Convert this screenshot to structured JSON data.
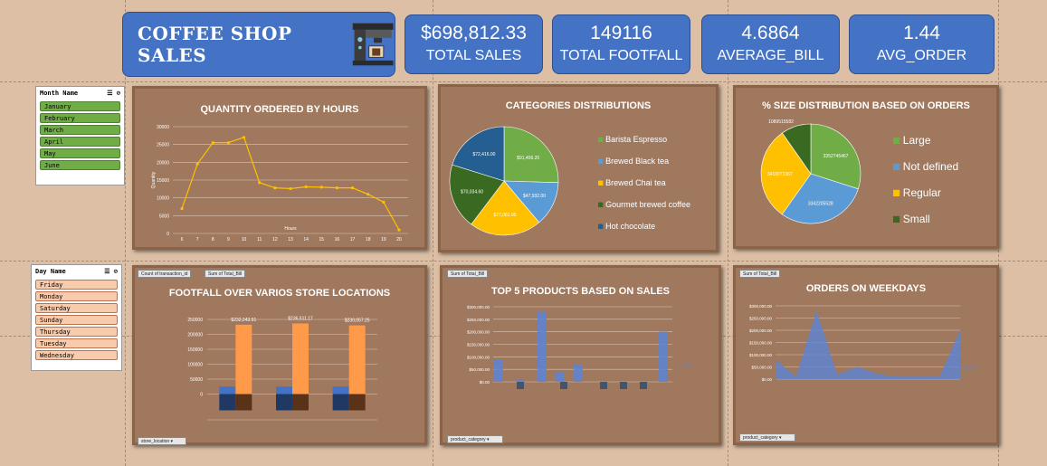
{
  "header": {
    "title": "COFFEE SHOP SALES",
    "icon": "coffee-machine-icon"
  },
  "kpis": [
    {
      "value": "$698,812.33",
      "label": "TOTAL SALES"
    },
    {
      "value": "149116",
      "label": "TOTAL FOOTFALL"
    },
    {
      "value": "4.6864",
      "label": "AVERAGE_BILL"
    },
    {
      "value": "1.44",
      "label": "AVG_ORDER"
    }
  ],
  "month_slicer": {
    "title": "Month Name",
    "items": [
      "January",
      "February",
      "March",
      "April",
      "May",
      "June"
    ],
    "item_color": "#70ad47"
  },
  "day_slicer": {
    "title": "Day Name",
    "items": [
      "Friday",
      "Monday",
      "Saturday",
      "Sunday",
      "Thursday",
      "Tuesday",
      "Wednesday"
    ],
    "item_color": "#f8cbad"
  },
  "panels": {
    "p1": {
      "title": "QUANTITY ORDERED BY HOURS"
    },
    "p2": {
      "title": "CATEGORIES DISTRIBUTIONS"
    },
    "p3": {
      "title": "% SIZE DISTRIBUTION BASED ON ORDERS"
    },
    "p4": {
      "title": "FOOTFALL OVER VARIOS STORE LOCATIONS",
      "fields": [
        "Count of transaction_id",
        "Sum of Total_Bill"
      ],
      "axis_field": "store_location"
    },
    "p5": {
      "title": "TOP 5 PRODUCTS BASED ON SALES",
      "fields": [
        "Sum of Total_Bill"
      ],
      "axis_field": "product_category"
    },
    "p6": {
      "title": "ORDERS ON WEEKDAYS",
      "fields": [
        "Sum of Total_Bill"
      ],
      "axis_field": "product_category"
    }
  },
  "chart_data": [
    {
      "type": "line",
      "title": "QUANTITY ORDERED BY HOURS",
      "xlabel": "Hours",
      "ylabel": "Quantity",
      "x": [
        6,
        7,
        8,
        9,
        10,
        11,
        12,
        13,
        14,
        15,
        16,
        17,
        18,
        19,
        20
      ],
      "values": [
        7000,
        19500,
        25500,
        25500,
        27000,
        14300,
        12800,
        12600,
        13100,
        13000,
        12800,
        12800,
        11000,
        8800,
        1000
      ],
      "ylim": [
        0,
        30000
      ],
      "yticks": [
        "0",
        "5000",
        "10000",
        "15000",
        "20000",
        "25000",
        "30000"
      ],
      "color": "#ffc000"
    },
    {
      "type": "pie",
      "title": "CATEGORIES DISTRIBUTIONS",
      "labels": [
        "Barista Espresso",
        "Brewed Black tea",
        "Brewed Chai tea",
        "Gourmet brewed coffee",
        "Hot chocolate"
      ],
      "values": [
        91406.2,
        47932.0,
        77081.95,
        70034.6,
        72416.0
      ],
      "data_labels": [
        "$91,406.20",
        "$47,932.00",
        "$77,081.95",
        "$70,034.60",
        "$72,416.00"
      ],
      "colors": [
        "#70ad47",
        "#5b9bd5",
        "#ffc000",
        "#3a6a22",
        "#255e91"
      ]
    },
    {
      "type": "pie",
      "title": "% SIZE DISTRIBUTION BASED ON ORDERS",
      "labels": [
        "Large",
        "Not defined",
        "Regular",
        "Small"
      ],
      "values": [
        3352745467,
        3342205528,
        3410071367,
        1089515582
      ],
      "data_labels": [
        "3352745467",
        "3342205528",
        "3410071367",
        "1089515582"
      ],
      "colors": [
        "#70ad47",
        "#5b9bd5",
        "#ffc000",
        "#3a6a22"
      ]
    },
    {
      "type": "bar",
      "title": "FOOTFALL OVER VARIOS STORE LOCATIONS",
      "categories": [
        "",
        "",
        ""
      ],
      "series": [
        {
          "values": [
            25000,
            25000,
            25000
          ],
          "color": "#4472c4"
        },
        {
          "values": [
            232243.91,
            236511.17,
            230057.25
          ],
          "color": "#ff9a4a"
        }
      ],
      "data_labels": [
        "$232,243.91",
        "$236,511.17",
        "$230,057.25"
      ],
      "yticks": [
        "0",
        "50000",
        "100000",
        "150000",
        "200000",
        "250000"
      ],
      "ylim": [
        -50000,
        250000
      ]
    },
    {
      "type": "bar",
      "title": "TOP 5 PRODUCTS BASED ON SALES",
      "values": [
        90000,
        10000,
        280000,
        40000,
        70000,
        200000
      ],
      "yticks": [
        "$0.00",
        "$50,000.00",
        "$100,000.00",
        "$150,000.00",
        "$200,000.00",
        "$250,000.00",
        "$300,000.00"
      ],
      "ylim": [
        0,
        300000
      ],
      "legend": "Total"
    },
    {
      "type": "area",
      "title": "ORDERS ON WEEKDAYS",
      "values": [
        80000,
        10000,
        280000,
        20000,
        50000,
        20000,
        10000,
        10000,
        10000,
        200000
      ],
      "yticks": [
        "$0.00",
        "$50,000.00",
        "$100,000.00",
        "$150,000.00",
        "$200,000.00",
        "$250,000.00",
        "$300,000.00"
      ],
      "ylim": [
        0,
        300000
      ],
      "legend": "Total"
    }
  ]
}
